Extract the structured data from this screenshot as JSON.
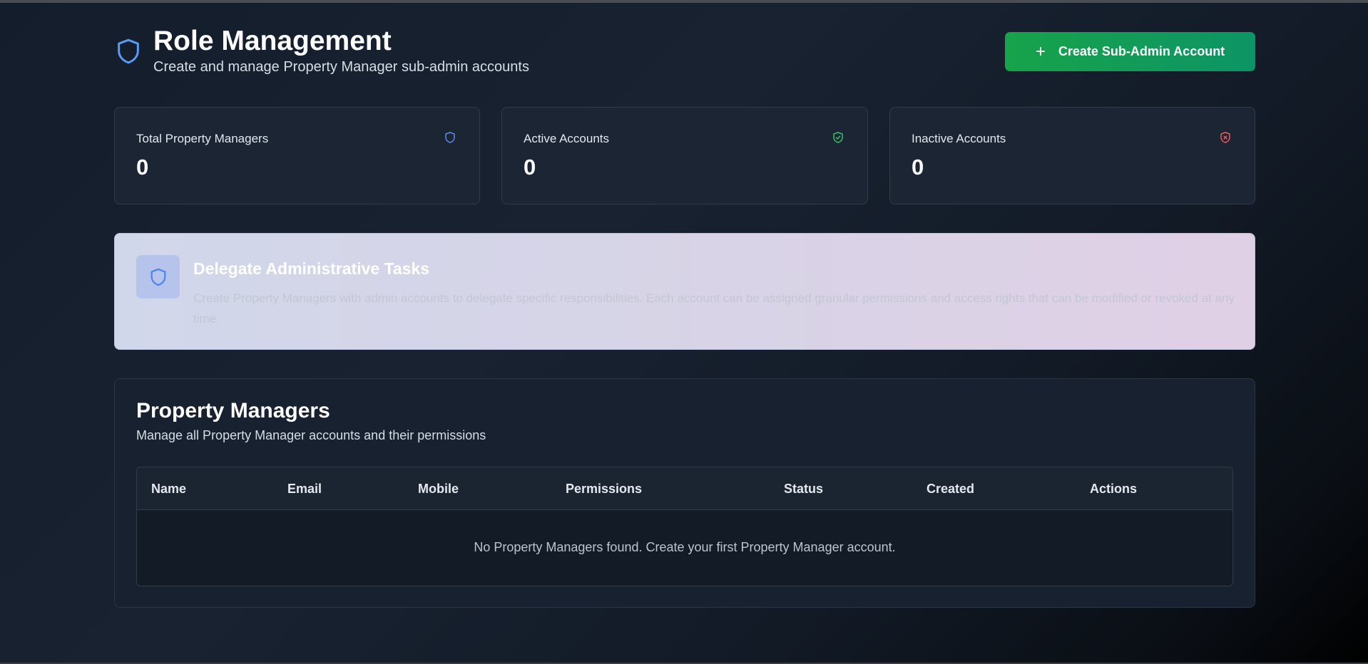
{
  "header": {
    "title": "Role Management",
    "subtitle": "Create and manage Property Manager sub-admin accounts",
    "create_button_label": "Create Sub-Admin Account"
  },
  "stats": [
    {
      "label": "Total Property Managers",
      "value": "0",
      "icon": "shield-icon",
      "color": "#5b8def"
    },
    {
      "label": "Active Accounts",
      "value": "0",
      "icon": "shield-check-icon",
      "color": "#35c26b"
    },
    {
      "label": "Inactive Accounts",
      "value": "0",
      "icon": "shield-x-icon",
      "color": "#ee5a5a"
    }
  ],
  "delegate": {
    "title": "Delegate Administrative Tasks",
    "text": "Create Property Managers with admin accounts to delegate specific responsibilities. Each account can be assigned granular permissions and access rights that can be modified or revoked at any time."
  },
  "property_managers": {
    "title": "Property Managers",
    "description": "Manage all Property Manager accounts and their permissions",
    "columns": [
      "Name",
      "Email",
      "Mobile",
      "Permissions",
      "Status",
      "Created",
      "Actions"
    ],
    "empty_message": "No Property Managers found. Create your first Property Manager account."
  },
  "colors": {
    "accent_green": "#17a34a",
    "accent_blue": "#5b8def"
  }
}
